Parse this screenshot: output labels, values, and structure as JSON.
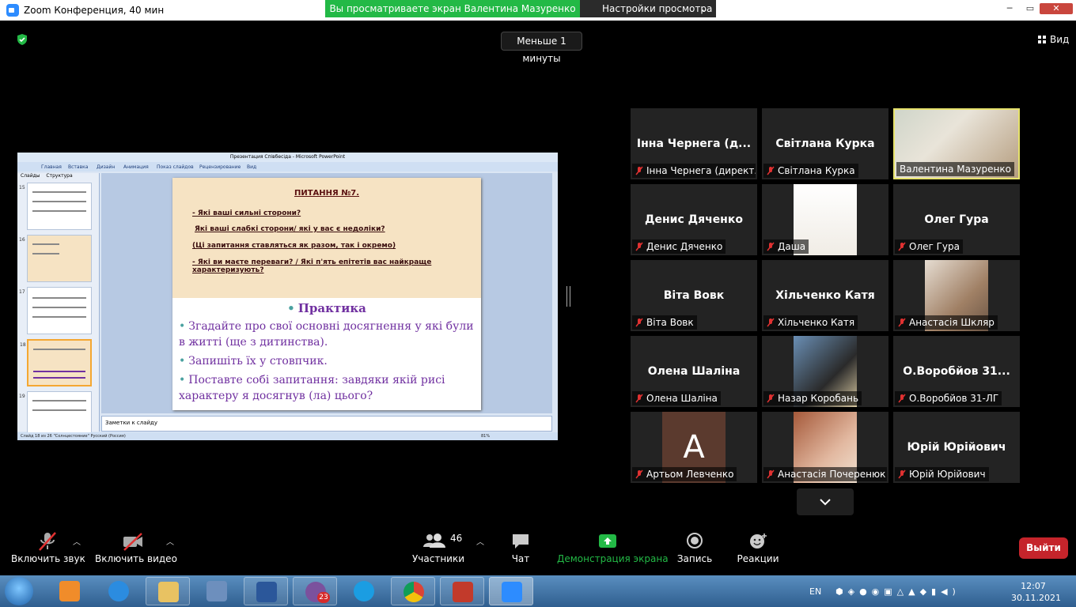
{
  "window": {
    "title": "Zoom Конференция, 40 мин"
  },
  "share_banner": {
    "text": "Вы просматриваете экран Валентина Мазуренко",
    "view_settings": "Настройки просмотра"
  },
  "timer": "Меньше 1 минуты",
  "view_button": "Вид",
  "powerpoint": {
    "title": "Презентация Співбесіда - Microsoft PowerPoint",
    "tabs": [
      "Главная",
      "Вставка",
      "Дизайн",
      "Анимация",
      "Показ слайдов",
      "Рецензирование",
      "Вид"
    ],
    "left_tabs": [
      "Слайды",
      "Структура"
    ],
    "thumb_numbers": [
      "15",
      "16",
      "17",
      "18",
      "19"
    ],
    "notes_placeholder": "Заметки к слайду",
    "status": "Слайд 18 из 26   \"Солнцестояние\"   Русский (Россия)",
    "zoom": "81%",
    "slide": {
      "heading": "ПИТАННЯ №7.",
      "q1": "- Які ваші сильні сторони?",
      "q2": "Які ваші слабкі сторони/ які у вас є недоліки?",
      "q3": "(Ці запитання ставляться як разом, так і окремо)",
      "q4": "- Які ви маєте переваги? / Які п'ять епітетів вас найкраще характеризують?",
      "practice": "Практика",
      "b1": "Згадайте про свої основні досягнення у які були в житті (ще з дитинства).",
      "b2": "Запишіть їх у стовпчик.",
      "b3": "Поставте собі запитання: завдяки якій рисі характеру я досягнув (ла) цього?"
    }
  },
  "participants_grid": [
    {
      "display": "Інна Чернега (д...",
      "label": "Інна Чернега (директ...",
      "muted": true,
      "video": false
    },
    {
      "display": "Світлана Курка",
      "label": "Світлана Курка",
      "muted": true,
      "video": false
    },
    {
      "display": "",
      "label": "Валентина Мазуренко",
      "muted": false,
      "video": true,
      "active": true
    },
    {
      "display": "Денис Дяченко",
      "label": "Денис Дяченко",
      "muted": true,
      "video": false
    },
    {
      "display": "",
      "label": "Даша",
      "muted": true,
      "video": true
    },
    {
      "display": "Олег Гура",
      "label": "Олег Гура",
      "muted": true,
      "video": false
    },
    {
      "display": "Віта Вовк",
      "label": "Віта Вовк",
      "muted": true,
      "video": false
    },
    {
      "display": "Хільченко Катя",
      "label": "Хільченко Катя",
      "muted": true,
      "video": false
    },
    {
      "display": "",
      "label": "Анастасія Шкляр",
      "muted": true,
      "video": true
    },
    {
      "display": "Олена Шаліна",
      "label": "Олена Шаліна",
      "muted": true,
      "video": false
    },
    {
      "display": "",
      "label": "Назар Коробань",
      "muted": true,
      "video": true
    },
    {
      "display": "О.Воробйов 31...",
      "label": "О.Воробйов 31-ЛГ",
      "muted": true,
      "video": false
    },
    {
      "display": "A",
      "label": "Артьом Левченко",
      "muted": true,
      "video": false
    },
    {
      "display": "",
      "label": "Анастасія Почеренюк",
      "muted": true,
      "video": true
    },
    {
      "display": "Юрій Юрійович",
      "label": "Юрій Юрійович",
      "muted": true,
      "video": false
    }
  ],
  "toolbar": {
    "audio": "Включить звук",
    "video": "Включить видео",
    "participants": "Участники",
    "participants_count": "46",
    "chat": "Чат",
    "share": "Демонстрация экрана",
    "record": "Запись",
    "reactions": "Реакции",
    "leave": "Выйти"
  },
  "taskbar": {
    "viber_badge": "23",
    "lang": "EN",
    "time": "12:07",
    "date": "30.11.2021"
  },
  "colors": {
    "share_green": "#23b946",
    "leave_red": "#c5242b",
    "active_border": "#e7e36c",
    "slide_purple": "#7030a0"
  }
}
